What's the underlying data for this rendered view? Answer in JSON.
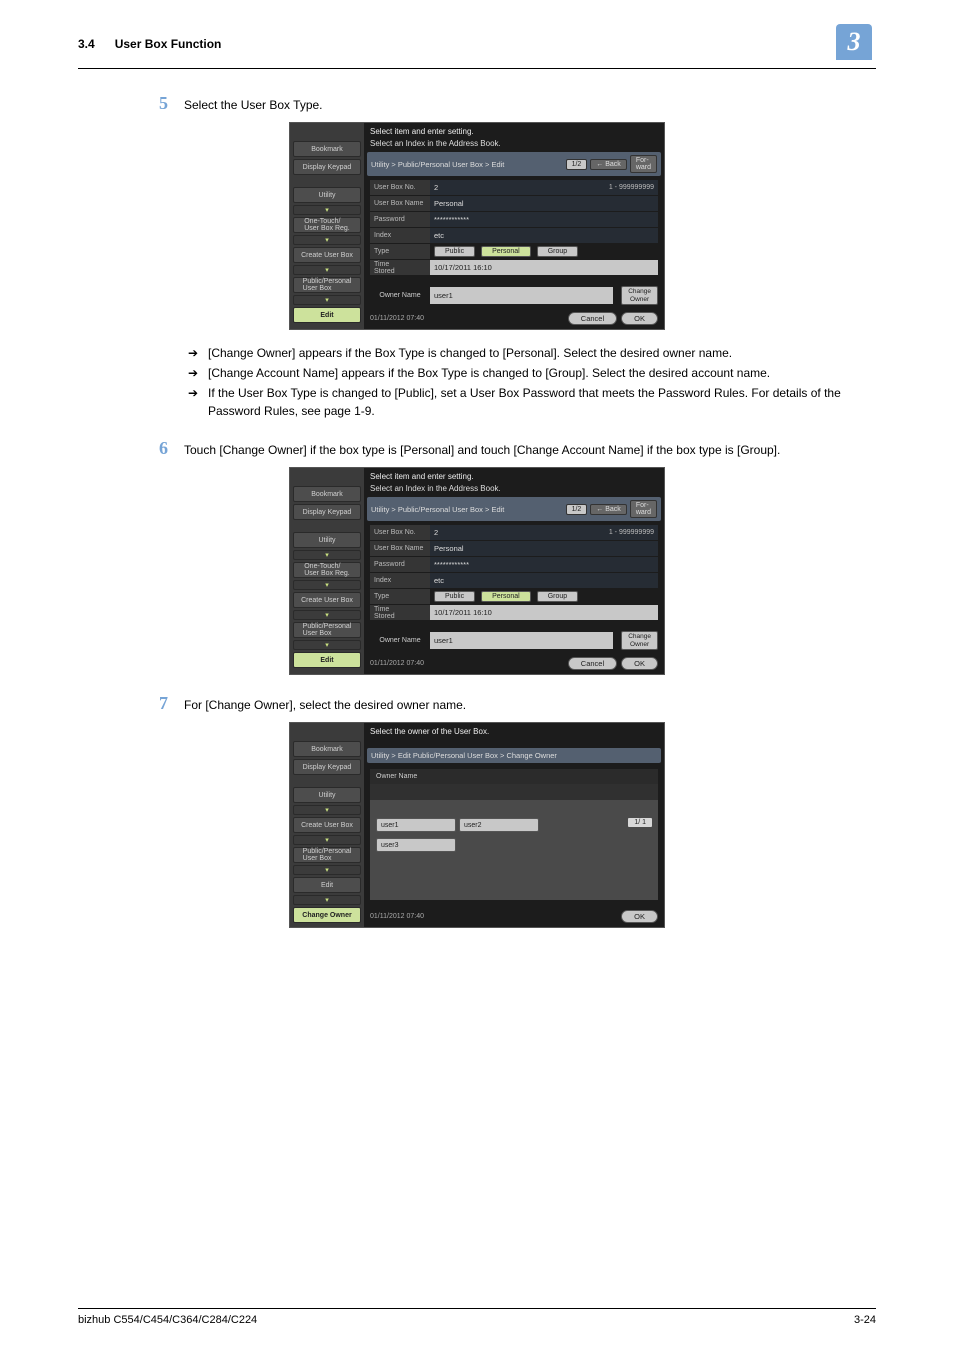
{
  "header": {
    "section_num": "3.4",
    "section_title": "User Box Function",
    "chapter_num": "3"
  },
  "footer": {
    "product": "bizhub C554/C454/C364/C284/C224",
    "page": "3-24"
  },
  "step5": {
    "num": "5",
    "text": "Select the User Box Type.",
    "bullets": [
      "[Change Owner] appears if the Box Type is changed to [Personal]. Select the desired owner name.",
      "[Change Account Name] appears if the Box Type is changed to [Group]. Select the desired account name.",
      "If the User Box Type is changed to [Public], set a User Box Password that meets the Password Rules. For details of the Password Rules, see page 1-9."
    ]
  },
  "step6": {
    "num": "6",
    "text": "Touch [Change Owner] if the box type is [Personal] and touch [Change Account Name] if the box type is [Group]."
  },
  "step7": {
    "num": "7",
    "text": "For [Change Owner], select the desired owner name."
  },
  "panelA": {
    "title": "Select item and enter setting.",
    "subtitle": "Select an Index in the Address Book.",
    "crumb": "Utility > Public/Personal User  Box > Edit",
    "page": "1/2",
    "back": "← Back",
    "forward": "For-\nward",
    "sidebar": [
      "Bookmark",
      "Display Keypad",
      "Utility",
      "One-Touch/\nUser Box Reg.",
      "Create User Box",
      "Public/Personal\nUser Box",
      "Edit"
    ],
    "fields": {
      "user_box_no": {
        "label": "User Box No.",
        "value": "2",
        "hint": "1 - 999999999"
      },
      "user_box_name": {
        "label": "User Box Name",
        "value": "Personal"
      },
      "password": {
        "label": "Password",
        "value": "************"
      },
      "index": {
        "label": "Index",
        "value": "etc"
      },
      "type": {
        "label": "Type",
        "public": "Public",
        "personal": "Personal",
        "group": "Group"
      },
      "time_stored": {
        "label": "Time\nStored",
        "value": "10/17/2011   16:10"
      },
      "owner_name": {
        "label": "Owner Name",
        "value": "user1",
        "change_owner": "Change\nOwner"
      }
    },
    "footer": {
      "time": "01/11/2012    07:40",
      "cancel": "Cancel",
      "ok": "OK"
    }
  },
  "panelC": {
    "title": "Select the owner of the User Box.",
    "crumb": "Utility > Edit Public/Personal User Box > Change Owner",
    "owner_name_label": "Owner Name",
    "sidebar": [
      "Bookmark",
      "Display Keypad",
      "Utility",
      "Create User Box",
      "Public/Personal\nUser Box",
      "Edit",
      "Change Owner"
    ],
    "users": [
      "user1",
      "user2",
      "user3"
    ],
    "page_ind": "1/  1",
    "footer": {
      "time": "01/11/2012    07:40",
      "ok": "OK"
    }
  }
}
